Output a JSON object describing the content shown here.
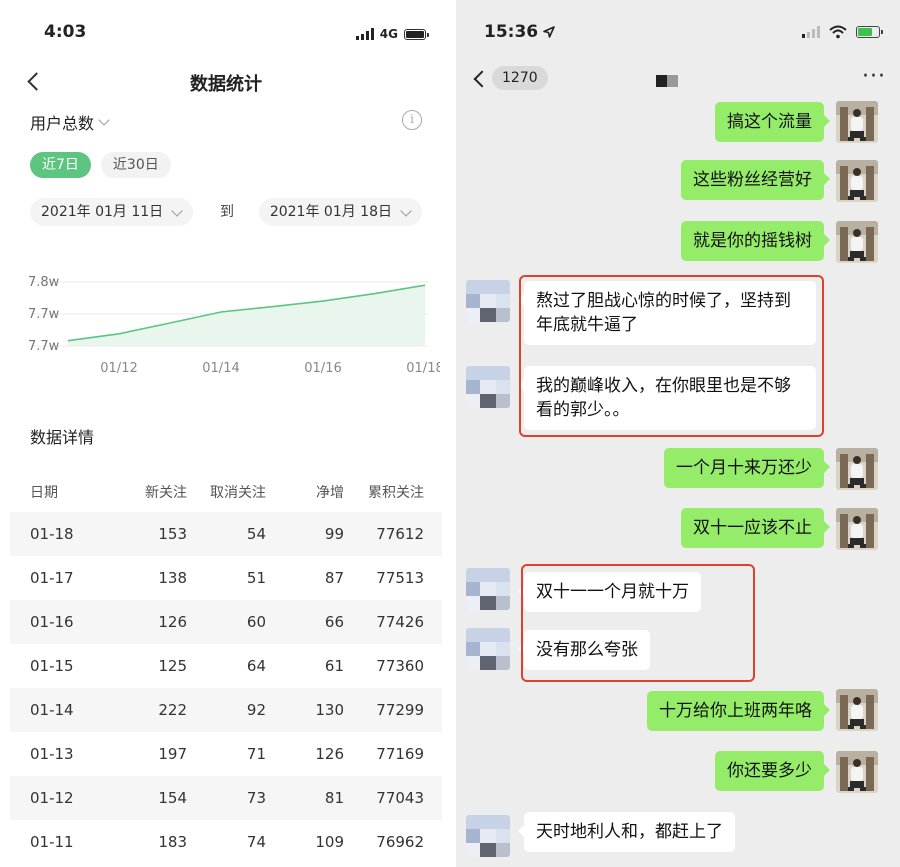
{
  "left": {
    "status": {
      "time": "4:03",
      "network": "4G"
    },
    "nav": {
      "title": "数据统计"
    },
    "metric": {
      "label": "用户总数"
    },
    "range_tabs": [
      {
        "label": "近7日",
        "active": true
      },
      {
        "label": "近30日",
        "active": false
      }
    ],
    "date_range": {
      "from": "2021年 01月 11日",
      "separator": "到",
      "to": "2021年 01月 18日"
    },
    "chart_data": {
      "type": "area",
      "x": [
        "01/11",
        "01/12",
        "01/13",
        "01/14",
        "01/15",
        "01/16",
        "01/17",
        "01/18"
      ],
      "y": [
        76962,
        77043,
        77169,
        77299,
        77360,
        77426,
        77513,
        77612
      ],
      "x_tick_labels": [
        "01/12",
        "01/14",
        "01/16",
        "01/18"
      ],
      "y_tick_labels": [
        "7.8w",
        "7.7w",
        "7.7w"
      ],
      "grid": true,
      "color": "#5cc57f"
    },
    "detail": {
      "title": "数据详情",
      "columns": [
        "日期",
        "新关注",
        "取消关注",
        "净增",
        "累积关注"
      ],
      "rows": [
        [
          "01-18",
          "153",
          "54",
          "99",
          "77612"
        ],
        [
          "01-17",
          "138",
          "51",
          "87",
          "77513"
        ],
        [
          "01-16",
          "126",
          "60",
          "66",
          "77426"
        ],
        [
          "01-15",
          "125",
          "64",
          "61",
          "77360"
        ],
        [
          "01-14",
          "222",
          "92",
          "130",
          "77299"
        ],
        [
          "01-13",
          "197",
          "71",
          "126",
          "77169"
        ],
        [
          "01-12",
          "154",
          "73",
          "81",
          "77043"
        ],
        [
          "01-11",
          "183",
          "74",
          "109",
          "76962"
        ]
      ]
    }
  },
  "right": {
    "status": {
      "time": "15:36"
    },
    "nav": {
      "unread_count": "1270"
    },
    "messages": [
      {
        "from": "me",
        "text": "搞这个流量"
      },
      {
        "from": "me",
        "text": "这些粉丝经营好"
      },
      {
        "from": "me",
        "text": "就是你的摇钱树"
      },
      {
        "from": "them",
        "text": "熬过了胆战心惊的时候了，坚持到年底就牛逼了"
      },
      {
        "from": "them",
        "text": "我的巅峰收入，在你眼里也是不够看的郭少。。"
      },
      {
        "from": "me",
        "text": "一个月十来万还少"
      },
      {
        "from": "me",
        "text": "双十一应该不止"
      },
      {
        "from": "them",
        "text": "双十一一个月就十万"
      },
      {
        "from": "them",
        "text": "没有那么夸张"
      },
      {
        "from": "me",
        "text": "十万给你上班两年咯"
      },
      {
        "from": "me",
        "text": "你还要多少"
      },
      {
        "from": "them",
        "text": "天时地利人和，都赶上了"
      }
    ]
  }
}
